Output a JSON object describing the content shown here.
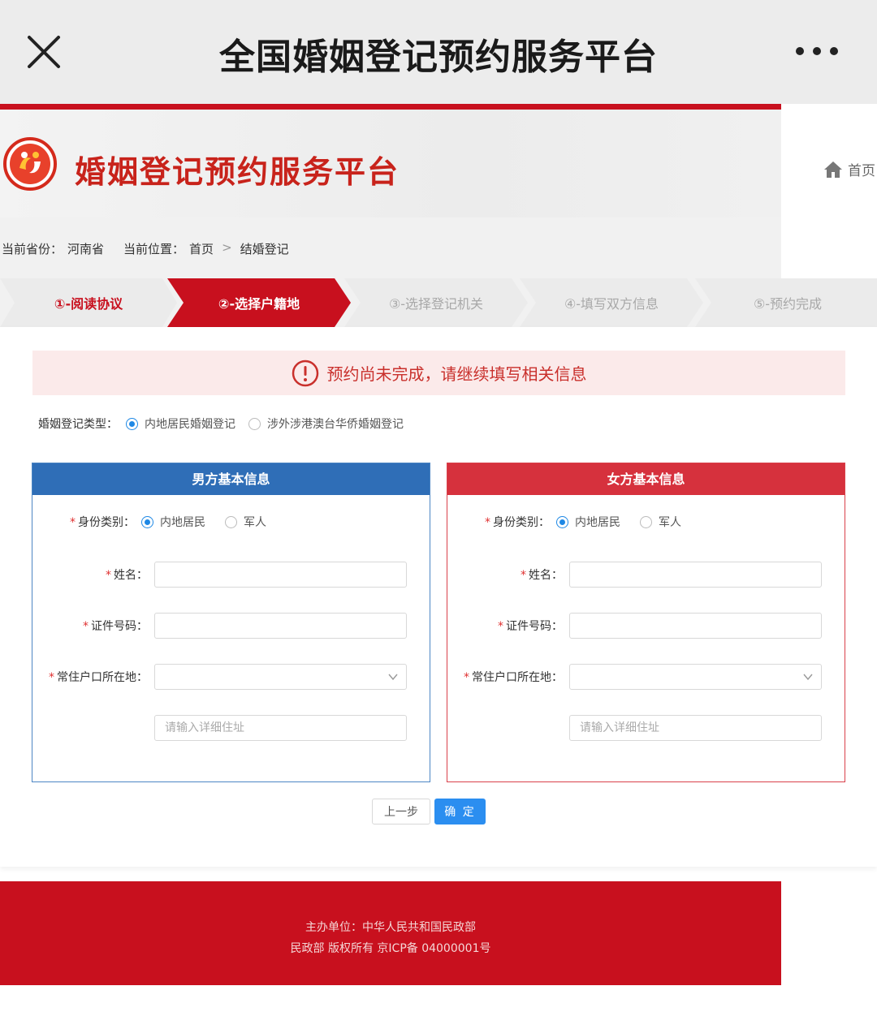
{
  "appbar": {
    "title": "全国婚姻登记预约服务平台"
  },
  "header": {
    "site_title": "婚姻登记预约服务平台",
    "home_label": "首页"
  },
  "breadcrumb": {
    "province_label": "当前省份：",
    "province": "河南省",
    "location_label": "当前位置：",
    "home": "首页",
    "separator": ">",
    "current": "结婚登记"
  },
  "steps": [
    {
      "label": "①-阅读协议",
      "state": "done"
    },
    {
      "label": "②-选择户籍地",
      "state": "active"
    },
    {
      "label": "③-选择登记机关",
      "state": "todo"
    },
    {
      "label": "④-填写双方信息",
      "state": "todo"
    },
    {
      "label": "⑤-预约完成",
      "state": "todo"
    }
  ],
  "alert": {
    "text": "预约尚未完成，请继续填写相关信息"
  },
  "registration_type": {
    "label": "婚姻登记类型：",
    "options": [
      "内地居民婚姻登记",
      "涉外涉港澳台华侨婚姻登记"
    ],
    "selected": "内地居民婚姻登记"
  },
  "male": {
    "title": "男方基本信息",
    "identity_label": "身份类别：",
    "identity_options": [
      "内地居民",
      "军人"
    ],
    "name_label": "姓名：",
    "id_label": "证件号码：",
    "residence_label": "常住户口所在地：",
    "address_placeholder": "请输入详细住址",
    "name_value": "",
    "id_value": "",
    "residence_value": ""
  },
  "female": {
    "title": "女方基本信息",
    "identity_label": "身份类别：",
    "identity_options": [
      "内地居民",
      "军人"
    ],
    "name_label": "姓名：",
    "id_label": "证件号码：",
    "residence_label": "常住户口所在地：",
    "address_placeholder": "请输入详细住址",
    "name_value": "",
    "id_value": "",
    "residence_value": ""
  },
  "buttons": {
    "prev": "上一步",
    "confirm": "确 定"
  },
  "footer": {
    "line1": "主办单位：中华人民共和国民政部",
    "line2": "民政部 版权所有 京ICP备 04000001号"
  },
  "colors": {
    "brand_red": "#c8101e",
    "male_blue": "#2f6eb7",
    "female_red": "#d6313d",
    "primary_button": "#2b8ef0"
  }
}
